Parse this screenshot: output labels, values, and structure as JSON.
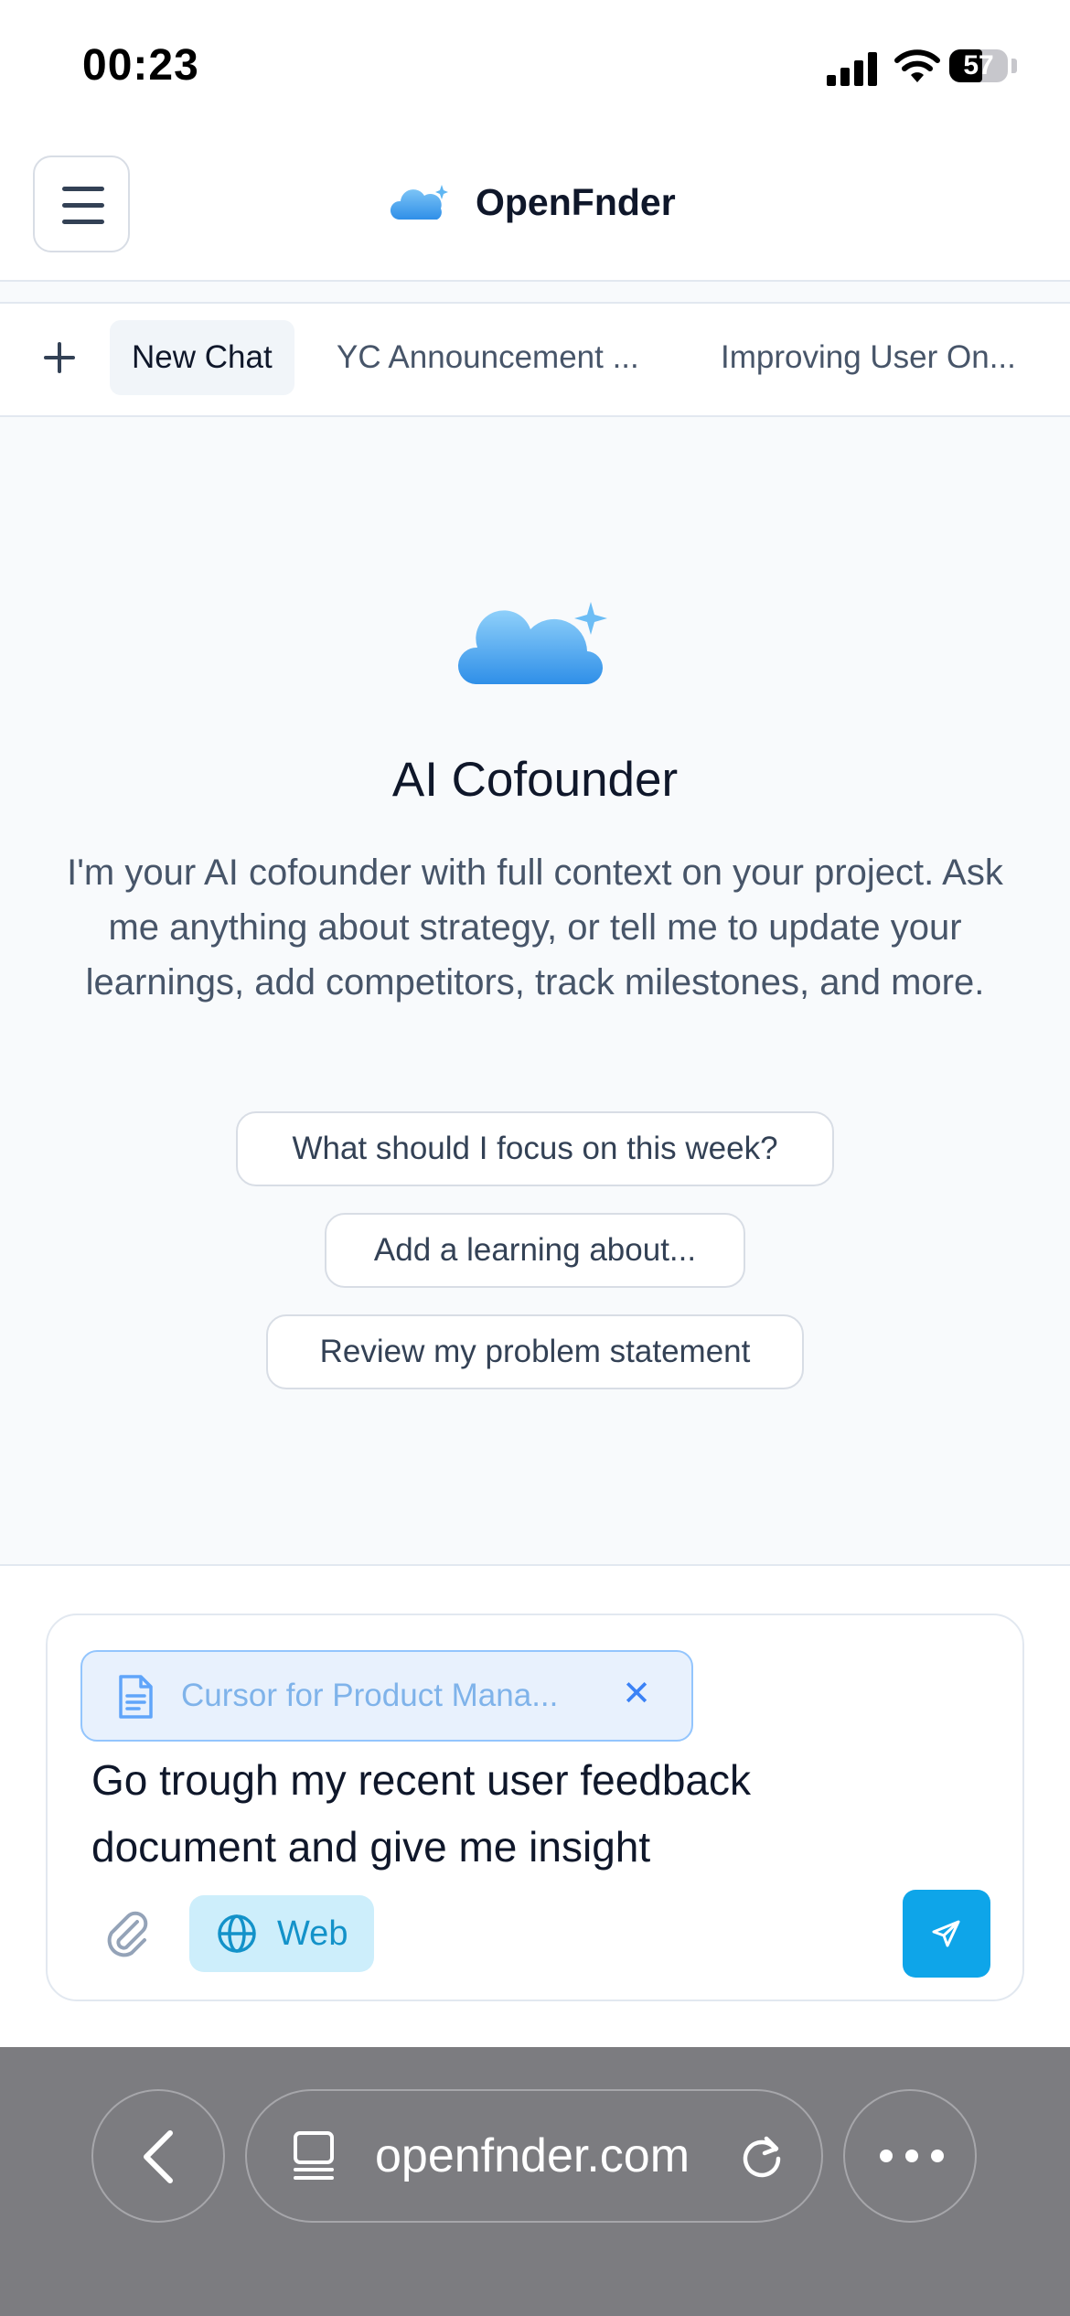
{
  "status_bar": {
    "time": "00:23",
    "battery": "57",
    "battery_level": 0.57
  },
  "header": {
    "brand": "OpenFnder",
    "menu_icon": "hamburger-icon",
    "logo_icon": "cloud-sparkle-icon"
  },
  "tabs": [
    {
      "label": "New Chat",
      "active": true
    },
    {
      "label": "YC Announcement ...",
      "active": false
    },
    {
      "label": "Improving User On...",
      "active": false
    }
  ],
  "hero": {
    "title": "AI Cofounder",
    "description": "I'm your AI cofounder with full context on your project. Ask me anything about strategy, or tell me to update your learnings, add competitors, track milestones, and more."
  },
  "suggestions": [
    "What should I focus on this week?",
    "Add a learning about...",
    "Review my problem statement"
  ],
  "composer": {
    "attachment_name": "Cursor for Product Mana...",
    "attachment_remove": "✕",
    "message": "Go trough my recent user feedback document and give me insight",
    "web_label": "Web"
  },
  "browser": {
    "url": "openfnder.com"
  },
  "colors": {
    "accent": "#0ea5e9",
    "web_toggle_bg": "#cdeefb",
    "chip_bg": "#e8f1fd",
    "browser_bar": "#7c7c80"
  }
}
